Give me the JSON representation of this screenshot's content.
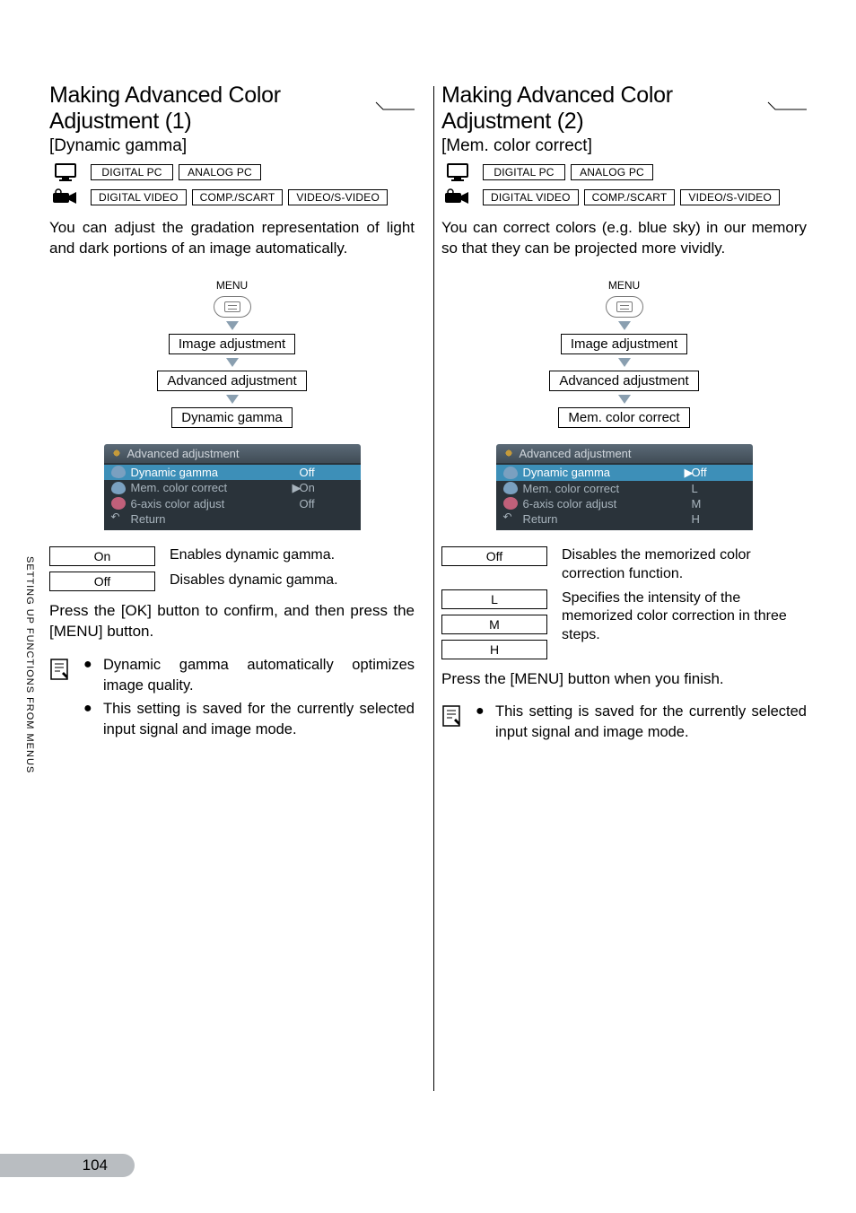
{
  "side_tab": "SETTING UP FUNCTIONS FROM MENUS",
  "page_number": "104",
  "left": {
    "title": "Making Advanced Color Adjustment (1)",
    "subtitle": "[Dynamic gamma]",
    "pc_tags": [
      "DIGITAL PC",
      "ANALOG PC"
    ],
    "video_tags": [
      "DIGITAL VIDEO",
      "COMP./SCART",
      "VIDEO/S-VIDEO"
    ],
    "body": "You can adjust the gradation representation of light and dark portions of an image automatically.",
    "menu_label": "MENU",
    "path": [
      "Image adjustment",
      "Advanced adjustment",
      "Dynamic gamma"
    ],
    "osd_title": "Advanced adjustment",
    "osd_rows": [
      {
        "label": "Dynamic gamma",
        "value": "Off",
        "selected": true,
        "mark": ""
      },
      {
        "label": "Mem. color correct",
        "value": "On",
        "selected": false,
        "mark": "▶"
      },
      {
        "label": "6-axis color adjust",
        "value": "Off",
        "selected": false,
        "mark": ""
      },
      {
        "label": "Return",
        "value": "",
        "selected": false,
        "mark": ""
      }
    ],
    "options": [
      {
        "label": "On",
        "desc": "Enables dynamic gamma."
      },
      {
        "label": "Off",
        "desc": "Disables dynamic gamma."
      }
    ],
    "after_options": "Press the [OK] button to confirm, and then press the [MENU] button.",
    "notes": [
      "Dynamic gamma automatically optimizes image quality.",
      "This setting is saved for the currently selected input signal and image mode."
    ]
  },
  "right": {
    "title": "Making Advanced Color Adjustment (2)",
    "subtitle": "[Mem. color correct]",
    "pc_tags": [
      "DIGITAL PC",
      "ANALOG PC"
    ],
    "video_tags": [
      "DIGITAL VIDEO",
      "COMP./SCART",
      "VIDEO/S-VIDEO"
    ],
    "body": "You can correct colors (e.g. blue sky) in our memory so that they can be projected more vividly.",
    "menu_label": "MENU",
    "path": [
      "Image adjustment",
      "Advanced adjustment",
      "Mem. color correct"
    ],
    "osd_title": "Advanced adjustment",
    "osd_rows": [
      {
        "label": "Dynamic gamma",
        "value": "Off",
        "selected": true,
        "mark": "▶"
      },
      {
        "label": "Mem. color correct",
        "value": "L",
        "selected": false,
        "mark": ""
      },
      {
        "label": "6-axis color adjust",
        "value": "M",
        "selected": false,
        "mark": ""
      },
      {
        "label": "Return",
        "value": "H",
        "selected": false,
        "mark": ""
      }
    ],
    "options": [
      {
        "label": "Off",
        "desc": "Disables the memorized color correction function."
      },
      {
        "label": "L",
        "desc": "Specifies the intensity of the memorized color correction in three steps."
      },
      {
        "label": "M",
        "desc": ""
      },
      {
        "label": "H",
        "desc": ""
      }
    ],
    "after_options": "Press the [MENU] button when you finish.",
    "notes": [
      "This setting is saved for the currently selected input signal and image mode."
    ]
  }
}
